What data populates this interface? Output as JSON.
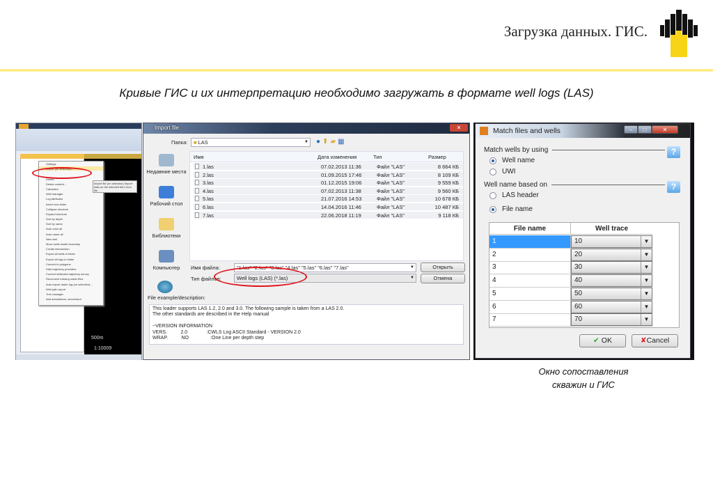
{
  "slide": {
    "title": "Загрузка данных. ГИС.",
    "subtitle": "Кривые ГИС и их интерпретацию необходимо загружать в формате well logs (LAS)",
    "caption_line1": "Окно сопоставления",
    "caption_line2": "скважин и ГИС",
    "accent_color": "#fde46a",
    "logo": "rosneft-logo"
  },
  "petrel": {
    "menu_items": [
      "Settings",
      "Import (on selection)...",
      "",
      "Delete",
      "Delete content...",
      "Calculator",
      "Well manager",
      "Log attributes",
      "Insert new folder",
      "Collapse structure",
      "Expand structure",
      "Sort by depth",
      "Sort by name",
      "Auto color all",
      "Auto name all",
      "New well",
      "Move wells inside boundary",
      "Create intersection",
      "Export all wells in folder",
      "Export all logs in folder",
      "Convert to polygons",
      "Hide trajectory providers",
      "Convert deflected trajectory survey",
      "Reconnect missing raster files",
      "Auto import raster log (on selection)...",
      "Well path report",
      "Tree manager",
      "Add annotations, screenshot"
    ],
    "tooltip": "Import file (on selection) Import data on the selected item from file",
    "scale": "500m",
    "ratio": "1:10009"
  },
  "import": {
    "title": "Import file",
    "folder_label": "Папка:",
    "folder": "LAS",
    "places": [
      "Недавние места",
      "Рабочий стол",
      "Библиотеки",
      "Компьютер"
    ],
    "columns": [
      "Имя",
      "Дата изменения",
      "Тип",
      "Размер"
    ],
    "files": [
      [
        "1.las",
        "07.02.2013 11:36",
        "Файл \"LAS\"",
        "8 664 КБ"
      ],
      [
        "2.las",
        "01.09.2015 17:46",
        "Файл \"LAS\"",
        "8 109 КБ"
      ],
      [
        "3.las",
        "01.12.2015 19:06",
        "Файл \"LAS\"",
        "9 559 КБ"
      ],
      [
        "4.las",
        "07.02.2013 11:38",
        "Файл \"LAS\"",
        "9 560 КБ"
      ],
      [
        "5.las",
        "21.07.2016 14:53",
        "Файл \"LAS\"",
        "10 678 КБ"
      ],
      [
        "6.las",
        "14.04.2016 11:46",
        "Файл \"LAS\"",
        "10 487 КБ"
      ],
      [
        "7.las",
        "22.06.2018 11:19",
        "Файл \"LAS\"",
        "9 118 КБ"
      ]
    ],
    "filename_label": "Имя файла:",
    "filename": "\"1.las\" \"2.las\" \"3.las\" \"4.las\" \"5.las\" \"6.las\" \"7.las\"",
    "type_label": "Тип файлов:",
    "type": "Well logs (LAS) (*.las)",
    "open": "Открыть",
    "cancel": "Отмена",
    "desc_label": "File example/description:",
    "desc": "This loader supports LAS 1.2, 2.0 and 3.0. The following sample is taken from a LAS 2.0.\nThe other standards are described in the Help manual\n\n~VERSION INFORMATION\nVERS.          2.0              :CWLS Log ASCII Standard - VERSION 2.0\nWRAP.          NO                :One Line per depth step"
  },
  "match": {
    "title": "Match files and wells",
    "sec1": "Match wells by using",
    "r1": "Well name",
    "r2": "UWI",
    "sec2": "Well name based on",
    "r3": "LAS header",
    "r4": "File name",
    "col1": "File name",
    "col2": "Well trace",
    "rows": [
      [
        "1",
        "10"
      ],
      [
        "2",
        "20"
      ],
      [
        "3",
        "30"
      ],
      [
        "4",
        "40"
      ],
      [
        "5",
        "50"
      ],
      [
        "6",
        "60"
      ],
      [
        "7",
        "70"
      ]
    ],
    "ok": "OK",
    "cancel": "Cancel",
    "help": "?"
  }
}
